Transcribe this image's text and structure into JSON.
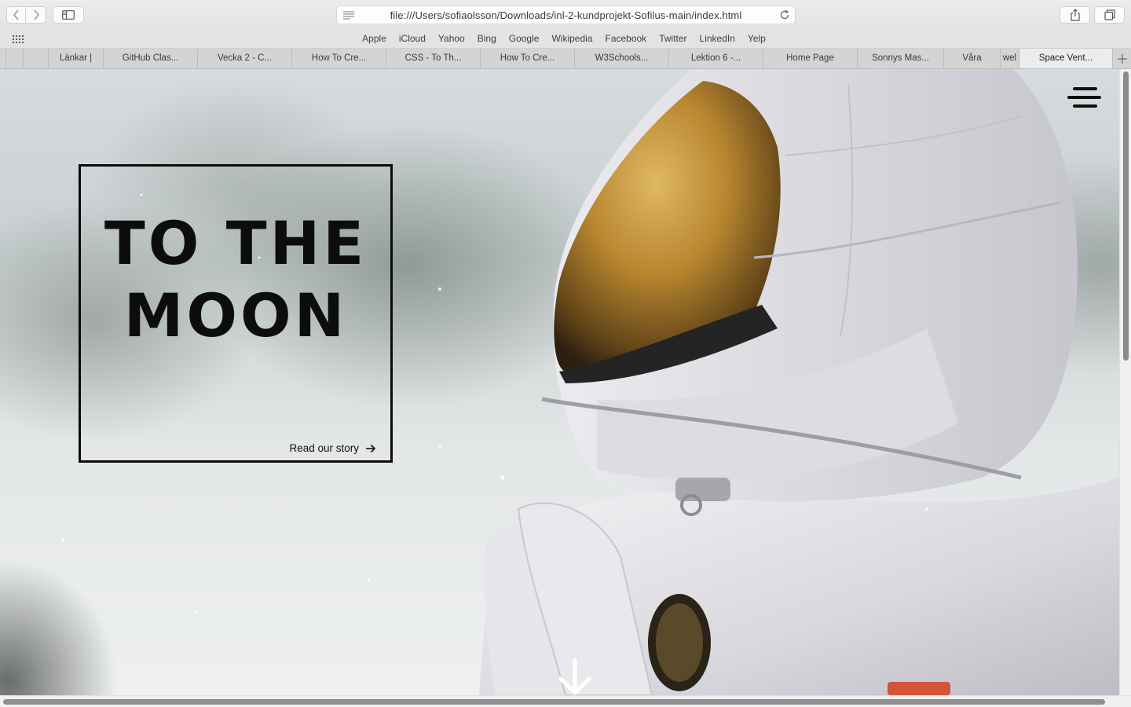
{
  "browser": {
    "url": "file:///Users/sofiaolsson/Downloads/inl-2-kundprojekt-Sofilus-main/index.html",
    "favorites": [
      "Apple",
      "iCloud",
      "Yahoo",
      "Bing",
      "Google",
      "Wikipedia",
      "Facebook",
      "Twitter",
      "LinkedIn",
      "Yelp"
    ],
    "tabs": [
      "Länkar |",
      "GitHub Clas...",
      "Vecka 2 - C...",
      "How To Cre...",
      "CSS - To Th...",
      "How To Cre...",
      "W3Schools...",
      "Lektion 6 -...",
      "Home Page",
      "Sonnys Mas...",
      "Våra",
      "wel",
      "Space Vent..."
    ],
    "active_tab_index": 12
  },
  "page": {
    "hero_line1": "TO THE",
    "hero_line2": "MOON",
    "read_link": "Read our story"
  },
  "icons": {
    "back": "chevron-left-icon",
    "forward": "chevron-right-icon",
    "sidebar": "sidebar-icon",
    "reader": "reader-icon",
    "reload": "reload-icon",
    "share": "share-icon",
    "tabs_overview": "tabs-overview-icon",
    "grid": "grid-icon",
    "new_tab": "plus-icon",
    "menu": "hamburger-icon",
    "read_arrow": "arrow-right-icon",
    "scroll_down": "arrow-down-icon"
  },
  "colors": {
    "hero_text": "#0d0d0d",
    "hero_border": "#0b0b0b",
    "visor": "#b8862f"
  }
}
